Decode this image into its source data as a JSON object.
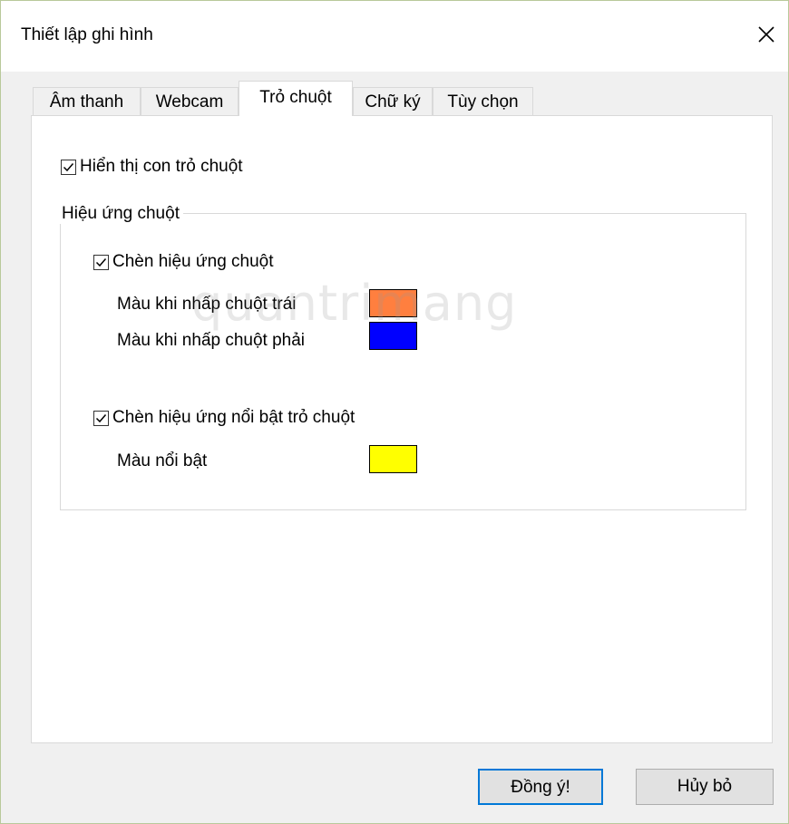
{
  "window": {
    "title": "Thiết lập ghi hình"
  },
  "tabs": [
    {
      "label": "Âm thanh",
      "active": false
    },
    {
      "label": "Webcam",
      "active": false
    },
    {
      "label": "Trỏ chuột",
      "active": true
    },
    {
      "label": "Chữ ký",
      "active": false
    },
    {
      "label": "Tùy chọn",
      "active": false
    }
  ],
  "panel": {
    "show_cursor": {
      "label": "Hiển thị con trỏ chuột",
      "checked": true
    },
    "group_title": "Hiệu ứng chuột",
    "click_effect": {
      "label": "Chèn hiệu ứng chuột",
      "checked": true
    },
    "left_click_label": "Màu khi nhấp chuột trái",
    "left_click_color": "#ff7f3f",
    "right_click_label": "Màu khi nhấp chuột phải",
    "right_click_color": "#0000ff",
    "highlight_effect": {
      "label": "Chèn hiệu ứng nổi bật trỏ chuột",
      "checked": true
    },
    "highlight_color_label": "Màu nổi bật",
    "highlight_color": "#ffff00"
  },
  "watermark": "quantrimang",
  "buttons": {
    "ok_label": "Đồng ý!",
    "cancel_label": "Hủy bỏ"
  }
}
